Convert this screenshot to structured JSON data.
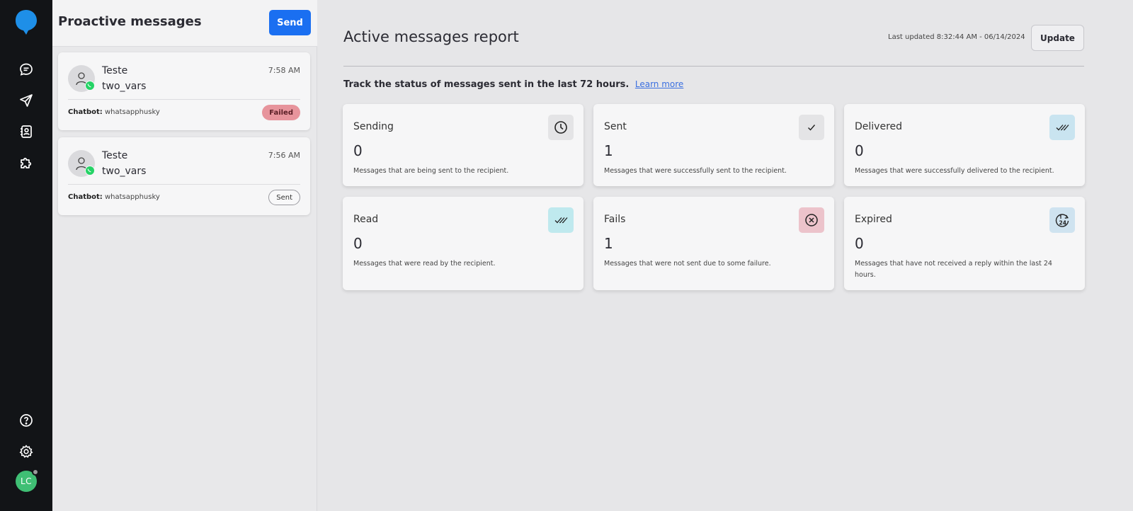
{
  "nav": {
    "icons": [
      "chat-icon",
      "send-icon",
      "contacts-icon",
      "puzzle-icon",
      "help-icon",
      "gear-icon"
    ],
    "avatar_initials": "LC"
  },
  "panel": {
    "title": "Proactive messages",
    "send_label": "Send",
    "messages": [
      {
        "name": "Teste",
        "template": "two_vars",
        "time": "7:58 AM",
        "chatbot_label": "Chatbot:",
        "chatbot": "whatsapphusky",
        "status": "Failed"
      },
      {
        "name": "Teste",
        "template": "two_vars",
        "time": "7:56 AM",
        "chatbot_label": "Chatbot:",
        "chatbot": "whatsapphusky",
        "status": "Sent"
      }
    ]
  },
  "report": {
    "title": "Active messages report",
    "last_updated": "Last updated 8:32:44 AM - 06/14/2024",
    "update_label": "Update",
    "track_text": "Track the status of messages sent in the last 72 hours.",
    "learn_more": "Learn more",
    "cards": [
      {
        "label": "Sending",
        "value": "0",
        "desc": "Messages that are being sent to the recipient.",
        "icon": "clock-icon",
        "icon_bg": "#e4e4e6"
      },
      {
        "label": "Sent",
        "value": "1",
        "desc": "Messages that were successfully sent to the recipient.",
        "icon": "check-icon",
        "icon_bg": "#e4e4e6"
      },
      {
        "label": "Delivered",
        "value": "0",
        "desc": "Messages that were successfully delivered to the recipient.",
        "icon": "double-check-icon",
        "icon_bg": "#c9e4f0"
      },
      {
        "label": "Read",
        "value": "0",
        "desc": "Messages that were read by the recipient.",
        "icon": "double-check-read-icon",
        "icon_bg": "#bfe9ee"
      },
      {
        "label": "Fails",
        "value": "1",
        "desc": "Messages that were not sent due to some failure.",
        "icon": "x-circle-icon",
        "icon_bg": "#ecc3cb"
      },
      {
        "label": "Expired",
        "value": "0",
        "desc": "Messages that have not received a reply within the last 24 hours.",
        "icon": "24h-icon",
        "icon_bg": "#cfe3f0"
      }
    ]
  },
  "colors": {
    "primary": "#1a6ff1",
    "sidebar": "#121417",
    "failed": "#e7949c",
    "whatsapp": "#25d366"
  }
}
